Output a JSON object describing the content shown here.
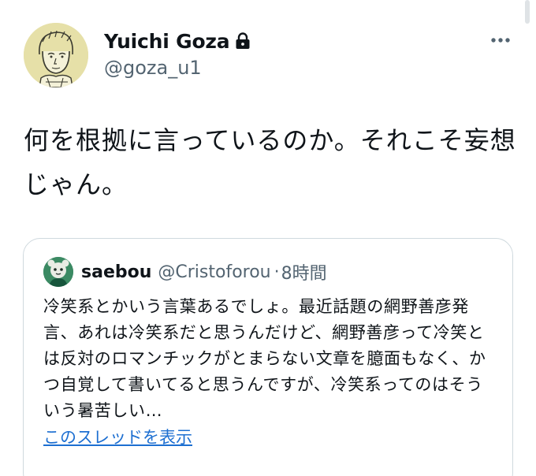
{
  "author": {
    "display_name": "Yuichi Goza",
    "handle": "@goza_u1",
    "avatar_icon": "sketched-portrait-avatar",
    "protected_icon": "lock-icon"
  },
  "tweet": {
    "text": "何を根拠に言っているのか。それこそ妄想じゃん。"
  },
  "quote": {
    "name": "saebou",
    "handle": "@Cristoforou",
    "separator": "·",
    "time": "8時間",
    "text": "冷笑系とかいう言葉あるでしょ。最近話題の網野善彦発言、あれは冷笑系だと思うんだけど、網野善彦って冷笑とは反対のロマンチックがとまらない文章を臆面もなく、かつ自覚して書いてると思うんですが、冷笑系ってのはそういう暑苦しい…",
    "show_thread": "このスレッドを表示"
  },
  "menu": {
    "more_icon": "more-options-icon"
  },
  "colors": {
    "text": "#0f1419",
    "secondary": "#536471",
    "link": "#1d6fd1",
    "border": "#cfd9de"
  }
}
